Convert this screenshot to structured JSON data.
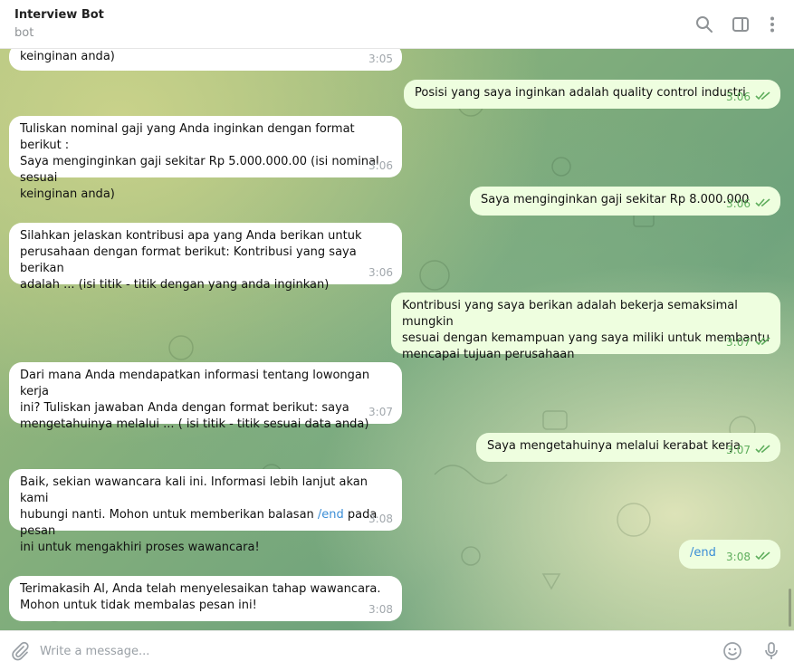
{
  "header": {
    "title": "Interview Bot",
    "subtitle": "bot",
    "icons": [
      "search-icon",
      "sidebar-toggle-icon",
      "more-vertical-icon"
    ]
  },
  "messages": [
    {
      "dir": "in",
      "text": "keinginan anda)",
      "time": "3:05"
    },
    {
      "dir": "out",
      "text": "Posisi yang saya inginkan adalah quality control industri",
      "time": "3:06"
    },
    {
      "dir": "in",
      "text": "Tuliskan nominal gaji yang Anda inginkan dengan format berikut :\nSaya menginginkan gaji sekitar Rp 5.000.000.00 (isi nominal sesuai\nkeinginan anda)",
      "time": "3:06"
    },
    {
      "dir": "out",
      "text": "Saya menginginkan gaji sekitar Rp 8.000.000",
      "time": "3:06"
    },
    {
      "dir": "in",
      "text": "Silahkan jelaskan kontribusi apa yang Anda berikan untuk\nperusahaan dengan format berikut: Kontribusi yang saya berikan\nadalah ... (isi titik - titik dengan yang anda inginkan)",
      "time": "3:06"
    },
    {
      "dir": "out",
      "text": "Kontribusi yang saya berikan adalah bekerja semaksimal mungkin\nsesuai dengan kemampuan yang saya miliki untuk membantu\nmencapai tujuan perusahaan",
      "time": "3:07"
    },
    {
      "dir": "in",
      "text": "Dari mana Anda mendapatkan informasi tentang lowongan kerja\nini? Tuliskan jawaban Anda dengan format berikut: saya\nmengetahuinya melalui ... ( isi titik - titik sesuai data anda)",
      "time": "3:07"
    },
    {
      "dir": "out",
      "text": "Saya mengetahuinya melalui kerabat kerja",
      "time": "3:07"
    },
    {
      "dir": "in",
      "text_before": "Baik, sekian wawancara kali ini. Informasi lebih lanjut akan kami\nhubungi nanti. Mohon untuk memberikan balasan ",
      "command": "/end",
      "text_after": " pada pesan\nini untuk mengakhiri proses wawancara!",
      "time": "3:08"
    },
    {
      "dir": "out",
      "command": "/end",
      "time": "3:08"
    },
    {
      "dir": "in",
      "text": "Terimakasih Al, Anda telah menyelesaikan tahap wawancara.\nMohon untuk tidak membalas pesan ini!",
      "time": "3:08"
    }
  ],
  "composer": {
    "placeholder": "Write a message...",
    "icons": [
      "attach-icon",
      "emoji-icon",
      "microphone-icon"
    ]
  },
  "colors": {
    "incoming_bubble": "#ffffff",
    "outgoing_bubble": "#eefedf",
    "read_check": "#5fae5d",
    "command_link": "#3a8dd6"
  }
}
